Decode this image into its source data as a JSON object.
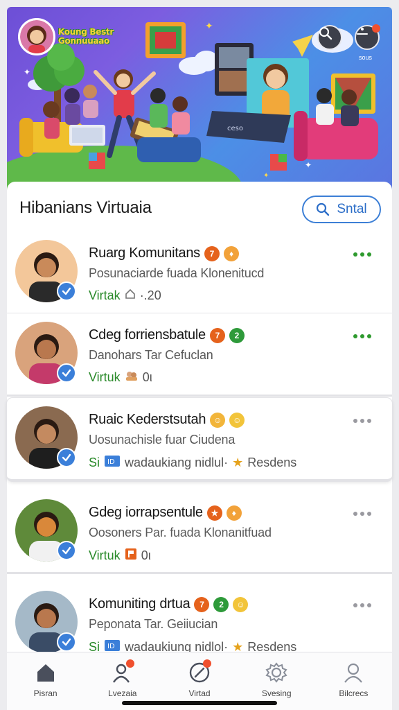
{
  "banner": {
    "logo_text": "Koung Bestr Gonnuuaao",
    "menu_caption": "sous",
    "monitor_text": "ceso"
  },
  "header": {
    "title": "Hibanians Virtuaia",
    "search_pill_label": "Sntal"
  },
  "communities": [
    {
      "name": "Ruarg Komunitans",
      "description": "Posunaciarde fuada Klonenitucd",
      "status": "Virtak",
      "meta_icon": "home-icon",
      "count": "·.20",
      "extra": "",
      "badges": [
        {
          "symbol": "7",
          "color": "#e5621c"
        },
        {
          "symbol": "♦",
          "color": "#f2a23a"
        }
      ],
      "dots_color": "#2e9a2e",
      "avatar_bg": "#f3c79a",
      "skin": "#c98a5a",
      "shirt": "#2a2a2a"
    },
    {
      "name": "Cdeg forriensbatule",
      "description": "Danohars Tar Cefuclan",
      "status": "Virtuk",
      "meta_icon": "people-icon",
      "count": "0ι",
      "extra": "",
      "badges": [
        {
          "symbol": "7",
          "color": "#e5621c"
        },
        {
          "symbol": "2",
          "color": "#2e9a3a"
        }
      ],
      "dots_color": "#2e9a2e",
      "avatar_bg": "#d9a37c",
      "skin": "#b9784e",
      "shirt": "#c43a6a"
    },
    {
      "name": "Ruaic Kederstsutah",
      "description": "Uosunachisle fuar Ciudena",
      "status": "Si",
      "meta_icon": "id-card-icon",
      "count": "wadaukiang nidlul·",
      "extra": "Resdens",
      "badges": [
        {
          "symbol": "☺",
          "color": "#f2b53a"
        },
        {
          "symbol": "☺",
          "color": "#f2c43a"
        }
      ],
      "dots_color": "#9a9aa0",
      "avatar_bg": "#8a6a50",
      "skin": "#c48a60",
      "shirt": "#1e1e1e"
    },
    {
      "name": "Gdeg iorrapsentule",
      "description": "Oosoners Par. fuada Klonanitfuad",
      "status": "Virtuk",
      "meta_icon": "flag-icon",
      "count": "0ι",
      "extra": "",
      "badges": [
        {
          "symbol": "★",
          "color": "#e5621c"
        },
        {
          "symbol": "♦",
          "color": "#f2a23a"
        }
      ],
      "dots_color": "#9a9aa0",
      "avatar_bg": "#5f8a3a",
      "skin": "#d9883a",
      "shirt": "#f1f1f1"
    },
    {
      "name": "Komuniting drtua",
      "description": "Peponata Tar. Geiiucian",
      "status": "Si",
      "meta_icon": "id-card-icon",
      "count": "wadaukiung nidlol·",
      "extra": "Resdens",
      "badges": [
        {
          "symbol": "7",
          "color": "#e5621c"
        },
        {
          "symbol": "2",
          "color": "#2e9a3a"
        },
        {
          "symbol": "☺",
          "color": "#f2c43a"
        }
      ],
      "dots_color": "#9a9aa0",
      "avatar_bg": "#a5b9c8",
      "skin": "#b9784e",
      "shirt": "#3a4c66"
    }
  ],
  "nav": [
    {
      "label": "Pisran",
      "icon": "home-icon",
      "dot": false
    },
    {
      "label": "Lvezaia",
      "icon": "user-icon",
      "dot": true
    },
    {
      "label": "Virtad",
      "icon": "compass-icon",
      "dot": true
    },
    {
      "label": "Svesing",
      "icon": "gear-icon",
      "dot": false
    },
    {
      "label": "Bilcrecs",
      "icon": "profile-icon",
      "dot": false
    }
  ]
}
